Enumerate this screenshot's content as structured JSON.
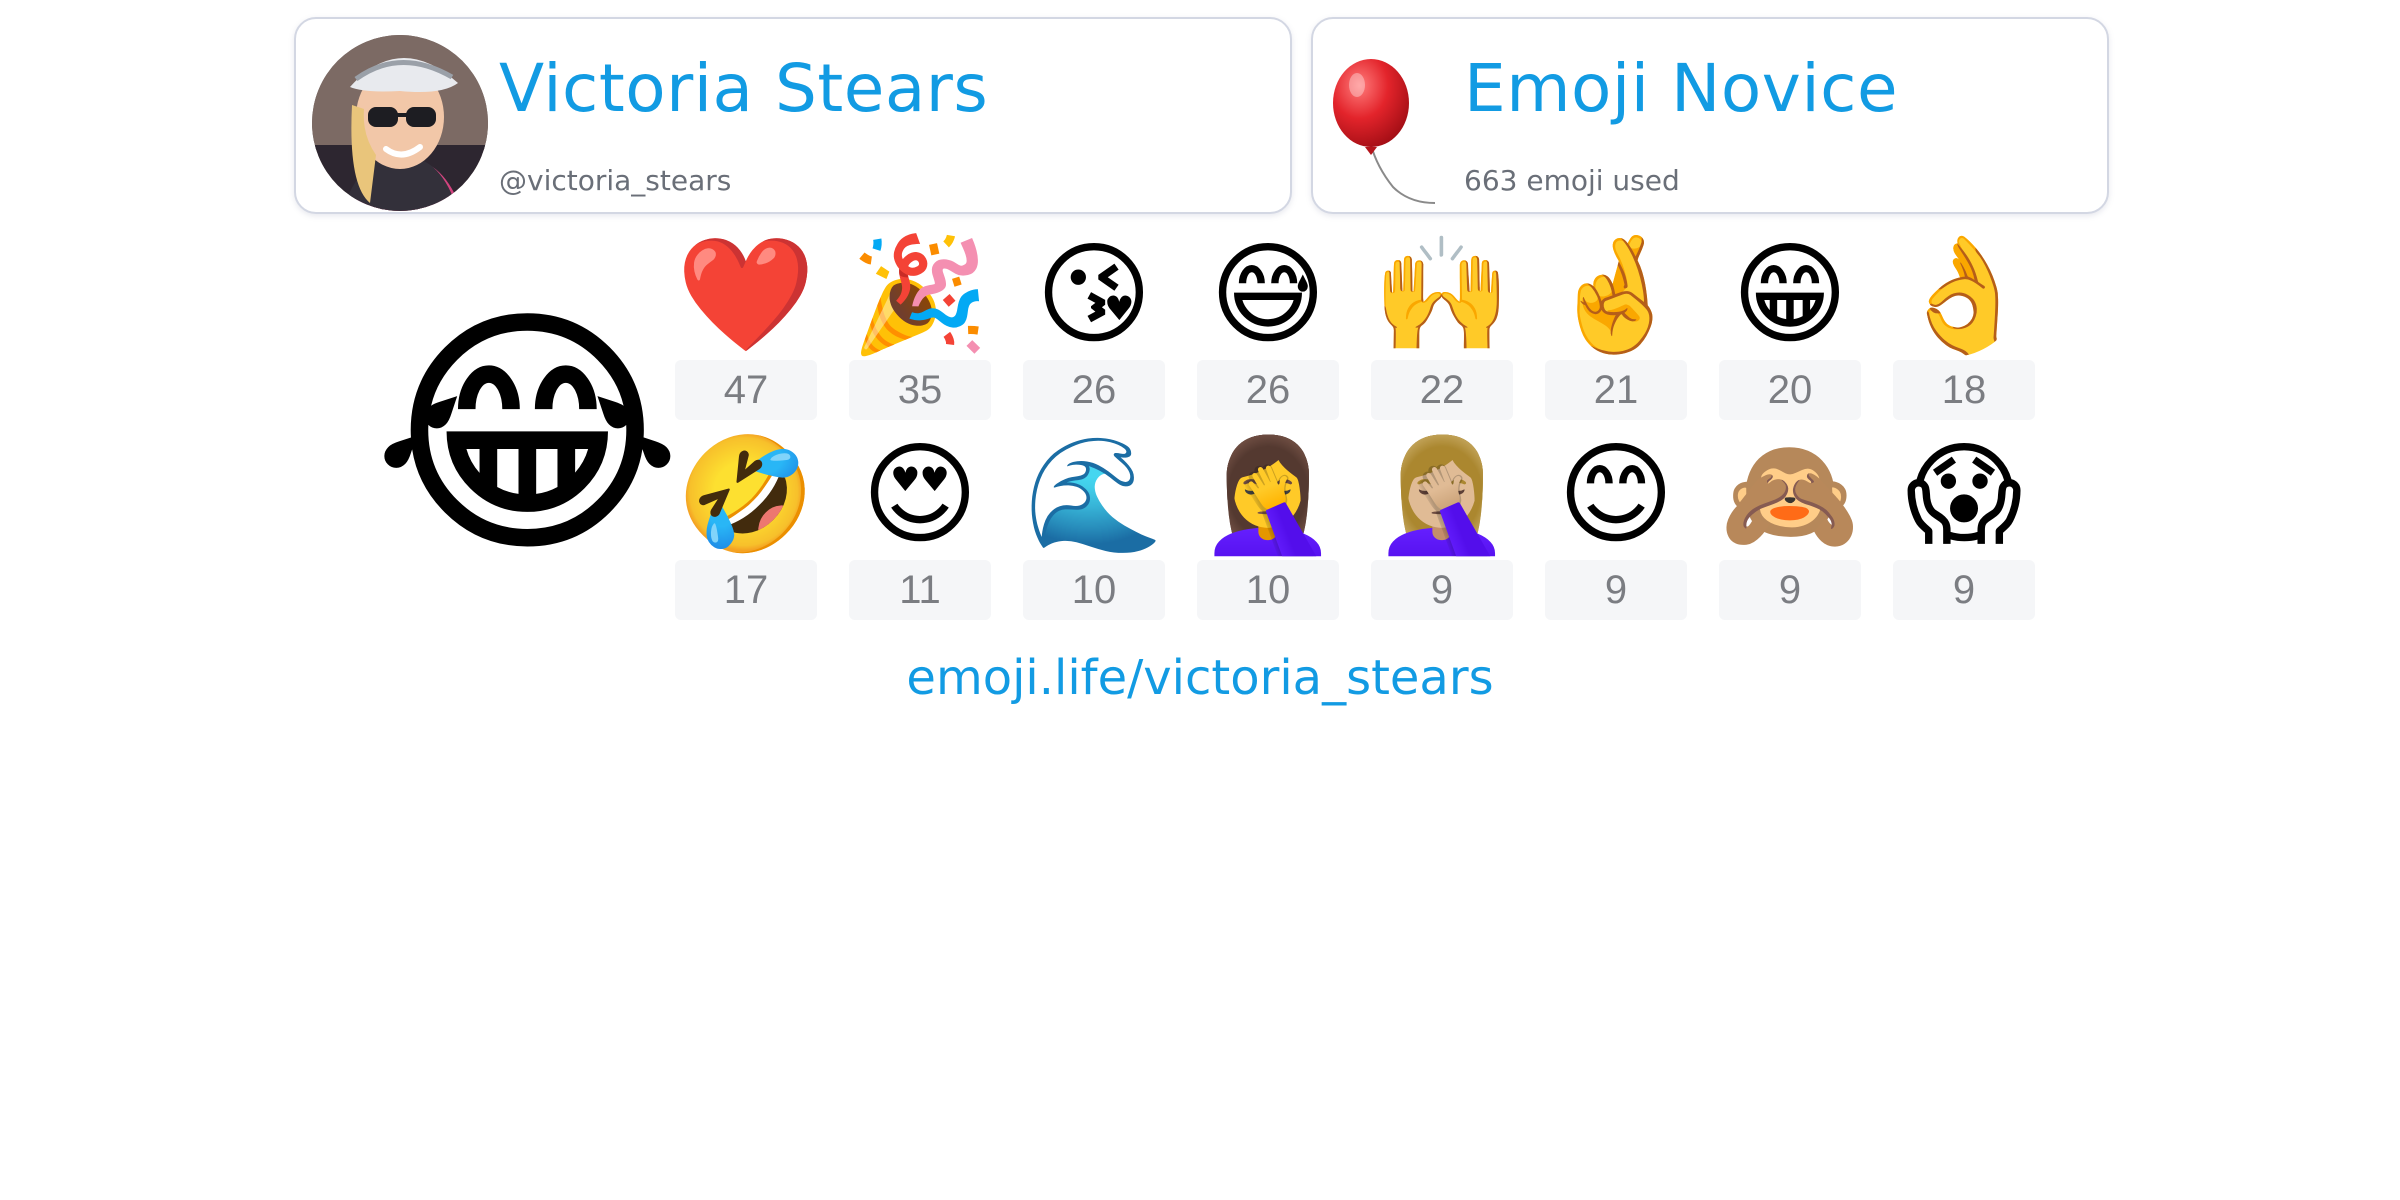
{
  "profile": {
    "name": "Victoria Stears",
    "handle": "@victoria_stears"
  },
  "rank": {
    "title": "Emoji Novice",
    "usage": "663 emoji used",
    "icon": "balloon-icon"
  },
  "top_emoji": "😂",
  "emoji_stats": [
    {
      "emoji": "❤️",
      "count": "47"
    },
    {
      "emoji": "🎉",
      "count": "35"
    },
    {
      "emoji": "😘",
      "count": "26"
    },
    {
      "emoji": "😅",
      "count": "26"
    },
    {
      "emoji": "🙌",
      "count": "22"
    },
    {
      "emoji": "🤞",
      "count": "21"
    },
    {
      "emoji": "😁",
      "count": "20"
    },
    {
      "emoji": "👌",
      "count": "18"
    },
    {
      "emoji": "🤣",
      "count": "17"
    },
    {
      "emoji": "😍",
      "count": "11"
    },
    {
      "emoji": "🌊",
      "count": "10"
    },
    {
      "emoji": "🤦‍♀️",
      "count": "10"
    },
    {
      "emoji": "🤦🏼‍♀️",
      "count": "9"
    },
    {
      "emoji": "😊",
      "count": "9"
    },
    {
      "emoji": "🙈",
      "count": "9"
    },
    {
      "emoji": "😱",
      "count": "9"
    }
  ],
  "link": "emoji.life/victoria_stears",
  "colors": {
    "accent": "#129be3",
    "count_text": "#7b7d82",
    "count_bg": "#f5f6f8",
    "card_border": "#d3d7e3"
  }
}
